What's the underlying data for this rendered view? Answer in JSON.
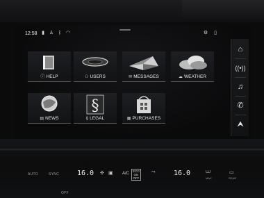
{
  "status_bar": {
    "time": "12:58"
  },
  "tiles": [
    {
      "label": "HELP",
      "icon": "info-icon"
    },
    {
      "label": "USERS",
      "icon": "user-icon"
    },
    {
      "label": "MESSAGES",
      "icon": "envelope-icon"
    },
    {
      "label": "WEATHER",
      "icon": "cloud-icon"
    },
    {
      "label": "NEWS",
      "icon": "news-icon"
    },
    {
      "label": "LEGAL",
      "icon": "section-icon"
    },
    {
      "label": "PURCHASES",
      "icon": "store-icon"
    }
  ],
  "side_nav": [
    {
      "name": "home",
      "icon": "home-icon"
    },
    {
      "name": "radio",
      "icon": "radio-icon"
    },
    {
      "name": "media",
      "icon": "music-note-icon"
    },
    {
      "name": "phone",
      "icon": "phone-icon"
    },
    {
      "name": "navigation",
      "icon": "navigation-arrow-icon"
    }
  ],
  "climate": {
    "auto": "AUTO",
    "sync": "SYNC",
    "temp_left": "16.0",
    "ac": "A/C",
    "eco_line1": "ECO",
    "eco_line2": "ON",
    "eco_line3": "OFF",
    "temp_right": "16.0",
    "off": "OFF",
    "max": "MAX",
    "rear": "REAR"
  },
  "accent_color": "#3a5e6e"
}
